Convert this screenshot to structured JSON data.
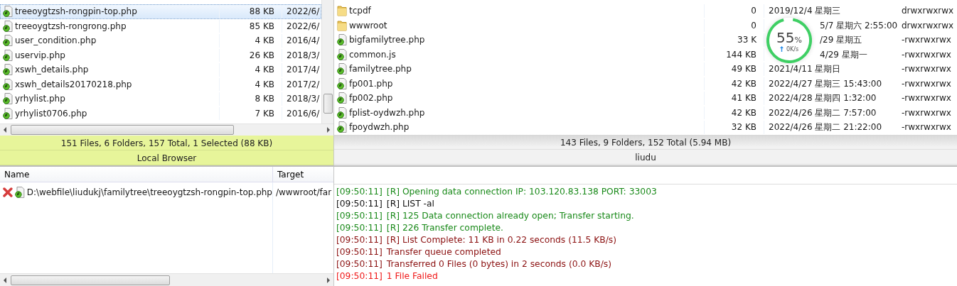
{
  "local_pane": {
    "rows": [
      {
        "name": "treeoygtzsh-rongpin-top.php",
        "size": "88 KB",
        "date": "2022/6/",
        "kind": "file",
        "selected": true
      },
      {
        "name": "treeoygtzsh-rongrong.php",
        "size": "85 KB",
        "date": "2022/6/",
        "kind": "file",
        "selected": false
      },
      {
        "name": "user_condition.php",
        "size": "4 KB",
        "date": "2016/4/",
        "kind": "file",
        "selected": false
      },
      {
        "name": "uservip.php",
        "size": "26 KB",
        "date": "2018/3/",
        "kind": "file",
        "selected": false
      },
      {
        "name": "xswh_details.php",
        "size": "4 KB",
        "date": "2017/4/",
        "kind": "file",
        "selected": false
      },
      {
        "name": "xswh_details20170218.php",
        "size": "4 KB",
        "date": "2017/2/",
        "kind": "file",
        "selected": false
      },
      {
        "name": "yrhylist.php",
        "size": "8 KB",
        "date": "2018/3/",
        "kind": "file",
        "selected": false
      },
      {
        "name": "yrhylist0706.php",
        "size": "7 KB",
        "date": "2016/6/",
        "kind": "file",
        "selected": false
      }
    ],
    "status": "151 Files, 6 Folders, 157 Total, 1 Selected (88 KB)",
    "label": "Local Browser"
  },
  "remote_pane": {
    "rows": [
      {
        "name": "tcpdf",
        "size": "0",
        "date": "2019/12/4 星期三",
        "perms": "drwxrwxrwx",
        "kind": "folder",
        "behind_meter": false
      },
      {
        "name": "wwwroot",
        "size": "0",
        "date": "5/7 星期六 2:55:00",
        "perms": "drwxrwxrwx",
        "kind": "folder",
        "behind_meter": true
      },
      {
        "name": "bigfamilytree.php",
        "size": "33 K",
        "date": "/29 星期五",
        "perms": "-rwxrwxrwx",
        "kind": "file",
        "behind_meter": true
      },
      {
        "name": "common.js",
        "size": "144 KB",
        "date": "4/29 星期一",
        "perms": "-rwxrwxrwx",
        "kind": "file",
        "behind_meter": true
      },
      {
        "name": "familytree.php",
        "size": "49 KB",
        "date": "2021/4/11 星期日",
        "perms": "-rwxrwxrwx",
        "kind": "file",
        "behind_meter": false
      },
      {
        "name": "fp001.php",
        "size": "42 KB",
        "date": "2022/4/27 星期三 15:43:00",
        "perms": "-rwxrwxrwx",
        "kind": "file",
        "behind_meter": false
      },
      {
        "name": "fp002.php",
        "size": "41 KB",
        "date": "2022/4/28 星期四 1:32:00",
        "perms": "-rwxrwxrwx",
        "kind": "file",
        "behind_meter": false
      },
      {
        "name": "fplist-oydwzh.php",
        "size": "42 KB",
        "date": "2022/4/26 星期二 7:57:00",
        "perms": "-rwxrwxrwx",
        "kind": "file",
        "behind_meter": false
      },
      {
        "name": "fpoydwzh.php",
        "size": "32 KB",
        "date": "2022/4/26 星期二 21:22:00",
        "perms": "-rwxrwxrwx",
        "kind": "file",
        "behind_meter": false
      }
    ],
    "status": "143 Files, 9 Folders, 152 Total (5.94 MB)",
    "label": "liudu"
  },
  "speed_meter": {
    "percent": "55",
    "unit": "%",
    "speed": "0K/s"
  },
  "queue": {
    "columns": [
      "Name",
      "Target"
    ],
    "rows": [
      {
        "name": "D:\\webfile\\liudukj\\familytree\\treeoygtzsh-rongpin-top.php",
        "target": "/wwwroot/far",
        "failed": true
      }
    ]
  },
  "log": [
    {
      "time": "[09:50:11]",
      "text": "[R] Opening data connection IP: 103.120.83.138 PORT: 33003",
      "kind": "reply"
    },
    {
      "time": "[09:50:11]",
      "text": "[R] LIST -al",
      "kind": "command"
    },
    {
      "time": "[09:50:11]",
      "text": "[R] 125 Data connection already open; Transfer starting.",
      "kind": "reply"
    },
    {
      "time": "[09:50:11]",
      "text": "[R] 226 Transfer complete.",
      "kind": "reply"
    },
    {
      "time": "[09:50:11]",
      "text": "[R] List Complete: 11 KB in 0.22 seconds (11.5 KB/s)",
      "kind": "status"
    },
    {
      "time": "[09:50:11]",
      "text": "Transfer queue completed",
      "kind": "status"
    },
    {
      "time": "[09:50:11]",
      "text": "Transferred 0 Files (0 bytes) in 2 seconds (0.0 KB/s)",
      "kind": "status"
    },
    {
      "time": "[09:50:11]",
      "text": "1 File Failed",
      "kind": "error"
    }
  ]
}
